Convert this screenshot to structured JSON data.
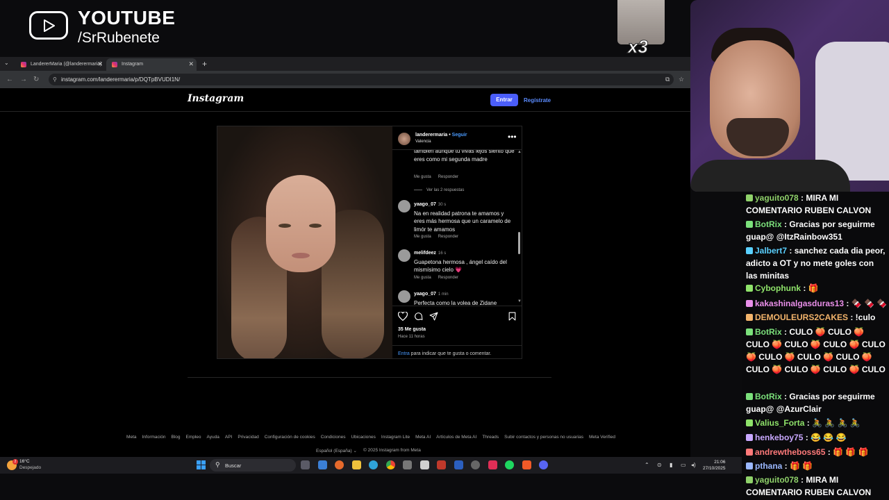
{
  "overlay": {
    "channel_title": "YOUTUBE",
    "channel_handle": "/SrRubenete",
    "sticker_label": "x3"
  },
  "browser": {
    "tabs": [
      {
        "label": "LandererMaria (@landerermaria)",
        "active": false
      },
      {
        "label": "Instagram",
        "active": true
      }
    ],
    "url": "instagram.com/landerermaria/p/DQTpBVUDI1N/"
  },
  "instagram": {
    "logo": "Instagram",
    "login_button": "Entrar",
    "register_link": "Regístrate",
    "post": {
      "username": "landerermaria",
      "separator": " • ",
      "follow": "Seguir",
      "location": "Valencia",
      "comments": [
        {
          "text": "también aunque tu vivas lejos siento que eres como mi segunda madre",
          "like": "Me gusta",
          "reply": "Responder",
          "view_replies": "Ver las 2 respuestas"
        },
        {
          "user": "yaago_07",
          "time": "30 s",
          "text": "Na en realidad patrona te amamos y eres más hermosa que un caramelo de limór te amamos",
          "like": "Me gusta",
          "reply": "Responder"
        },
        {
          "user": "melifdeez",
          "time": "16 s",
          "text": "Guapetona hermosa , ángel caído del mismísimo cielo 💗",
          "like": "Me gusta",
          "reply": "Responder"
        },
        {
          "user": "yaago_07",
          "time": "1 min",
          "text": "Perfecta como la volea de Zidane"
        }
      ],
      "likes": "35 Me gusta",
      "posted_ago": "Hace 11 horas",
      "login_link": "Entra",
      "login_hint": " para indicar que te gusta o comentar."
    },
    "footer_links": [
      "Meta",
      "Información",
      "Blog",
      "Empleo",
      "Ayuda",
      "API",
      "Privacidad",
      "Configuración de cookies",
      "Condiciones",
      "Ubicaciones",
      "Instagram Lite",
      "Meta AI",
      "Artículos de Meta AI",
      "Threads",
      "Subir contactos y personas no usuarias",
      "Meta Verified"
    ],
    "footer_language": "Español (España)",
    "footer_copyright": "© 2025 Instagram from Meta"
  },
  "taskbar": {
    "temperature": "16°C",
    "weather_condition": "Despejado",
    "weather_badge": "2",
    "search_placeholder": "Buscar",
    "time": "21:06",
    "date": "27/10/2025"
  },
  "chat": {
    "messages": [
      {
        "user": "yaguito078",
        "color": "#8fd16a",
        "text": " : MIRA MI COMENTARIO RUBEN CALVON"
      },
      {
        "user": "BotRix",
        "color": "#7be07b",
        "text": " : Gracias por seguirme guap@ @ItzRainbow351"
      },
      {
        "user": "Jalbert7",
        "color": "#5ad0ff",
        "text": " : sanchez cada dia peor, adicto a OT y no mete goles con las minitas"
      },
      {
        "user": "Cybophunk",
        "color": "#8fe36a",
        "text": " : 🎁"
      },
      {
        "user": "kakashinalgasduras13",
        "color": "#e98fe9",
        "text": " : 🍫 🍫 🍫"
      },
      {
        "user": "DEMOULEURS2CAKES",
        "color": "#f3b46b",
        "text": " : !culo"
      },
      {
        "user": "BotRix",
        "color": "#7be07b",
        "text": " : CULO 🍑 CULO 🍑 CULO 🍑 CULO 🍑 CULO 🍑 CULO 🍑 CULO 🍑 CULO 🍑 CULO 🍑 CULO 🍑 CULO 🍑 CULO 🍑 CULO"
      },
      {
        "user": "BotRix",
        "color": "#7be07b",
        "text": " : Gracias por seguirme guap@ @AzurClair"
      },
      {
        "user": "Valius_Forta",
        "color": "#8fe36a",
        "text": " : 🚴 🚴 🚴 🚴"
      },
      {
        "user": "henkeboy75",
        "color": "#c9a8ff",
        "text": " : 😂 😂 😂"
      },
      {
        "user": "andrewtheboss65",
        "color": "#ff7a7a",
        "text": " : 🎁 🎁 🎁"
      },
      {
        "user": "pthana",
        "color": "#9bb8ff",
        "text": " : 🎁 🎁"
      },
      {
        "user": "yaguito078",
        "color": "#8fd16a",
        "text": " : MIRA MI COMENTARIO RUBEN CALVON"
      }
    ]
  },
  "colors": {
    "ig_blue": "#4a5df9",
    "link_blue": "#4a9bff",
    "windows_blue": "#3aa0ff"
  },
  "icons": {
    "overlay": "youtube-play-icon",
    "post_actions": [
      "heart-icon",
      "comment-icon",
      "share-icon",
      "bookmark-icon"
    ],
    "taskbar": [
      "windows-start-icon",
      "search-icon",
      "file-explorer-icon",
      "firefox-icon",
      "chrome-icon",
      "edge-icon",
      "spotify-icon",
      "brave-icon",
      "discord-icon"
    ]
  }
}
